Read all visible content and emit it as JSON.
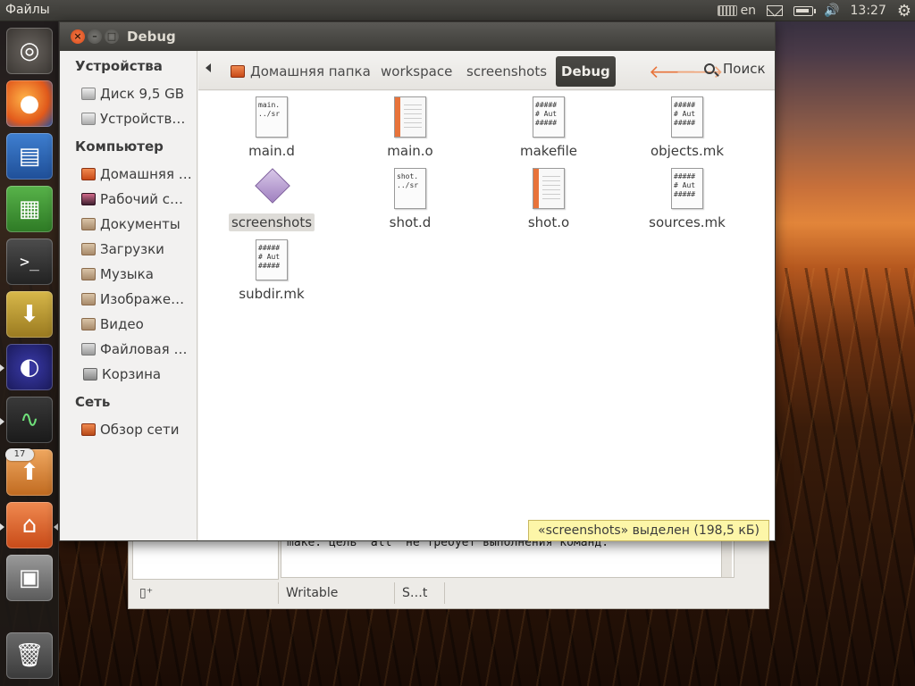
{
  "top_panel": {
    "app_title": "Файлы",
    "keyboard_layout": "en",
    "clock": "13:27"
  },
  "launcher": {
    "badge_count": "17",
    "items": [
      "ubuntu-icon",
      "firefox-icon",
      "writer-icon",
      "calc-icon",
      "terminal-icon",
      "software-install-icon",
      "eclipse-icon",
      "system-monitor-icon",
      "update-manager-icon",
      "home-folder-icon",
      "workspace-switcher-icon",
      "trash-icon"
    ]
  },
  "window": {
    "title": "Debug"
  },
  "sidebar": {
    "sections": [
      {
        "header": "Устройства",
        "items": [
          {
            "label": "Диск 9,5 GB",
            "icon": "disk-icon"
          },
          {
            "label": "Устройств…",
            "icon": "disk-icon"
          }
        ]
      },
      {
        "header": "Компьютер",
        "items": [
          {
            "label": "Домашняя …",
            "icon": "home-icon"
          },
          {
            "label": "Рабочий с…",
            "icon": "desktop-icon"
          },
          {
            "label": "Документы",
            "icon": "folder-icon"
          },
          {
            "label": "Загрузки",
            "icon": "folder-icon"
          },
          {
            "label": "Музыка",
            "icon": "folder-icon"
          },
          {
            "label": "Изображе…",
            "icon": "folder-icon"
          },
          {
            "label": "Видео",
            "icon": "folder-icon"
          },
          {
            "label": "Файловая …",
            "icon": "filesystem-icon"
          },
          {
            "label": "Корзина",
            "icon": "trash-icon"
          }
        ]
      },
      {
        "header": "Сеть",
        "items": [
          {
            "label": "Обзор сети",
            "icon": "network-icon"
          }
        ]
      }
    ]
  },
  "toolbar": {
    "breadcrumbs": [
      "Домашняя папка",
      "workspace",
      "screenshots",
      "Debug"
    ],
    "search_label": "Поиск"
  },
  "files": [
    {
      "name": "main.d",
      "preview": "main.\n../sr",
      "type": "text"
    },
    {
      "name": "main.o",
      "preview": "",
      "type": "object"
    },
    {
      "name": "makefile",
      "preview": "#####\n# Aut\n#####",
      "type": "text"
    },
    {
      "name": "objects.mk",
      "preview": "#####\n# Aut\n#####",
      "type": "text"
    },
    {
      "name": "screenshots",
      "preview": "",
      "type": "executable",
      "selected": true
    },
    {
      "name": "shot.d",
      "preview": "shot.\n../sr",
      "type": "text"
    },
    {
      "name": "shot.o",
      "preview": "",
      "type": "object"
    },
    {
      "name": "sources.mk",
      "preview": "#####\n# Aut\n#####",
      "type": "text"
    },
    {
      "name": "subdir.mk",
      "preview": "#####\n# Aut\n#####",
      "type": "text"
    }
  ],
  "status_tooltip": "«screenshots» выделен (198,5 кБ)",
  "background_window": {
    "console_text": "make: цель `all' не требует выполнения команд.",
    "status_writable": "Writable",
    "status_insert": "S…t"
  }
}
